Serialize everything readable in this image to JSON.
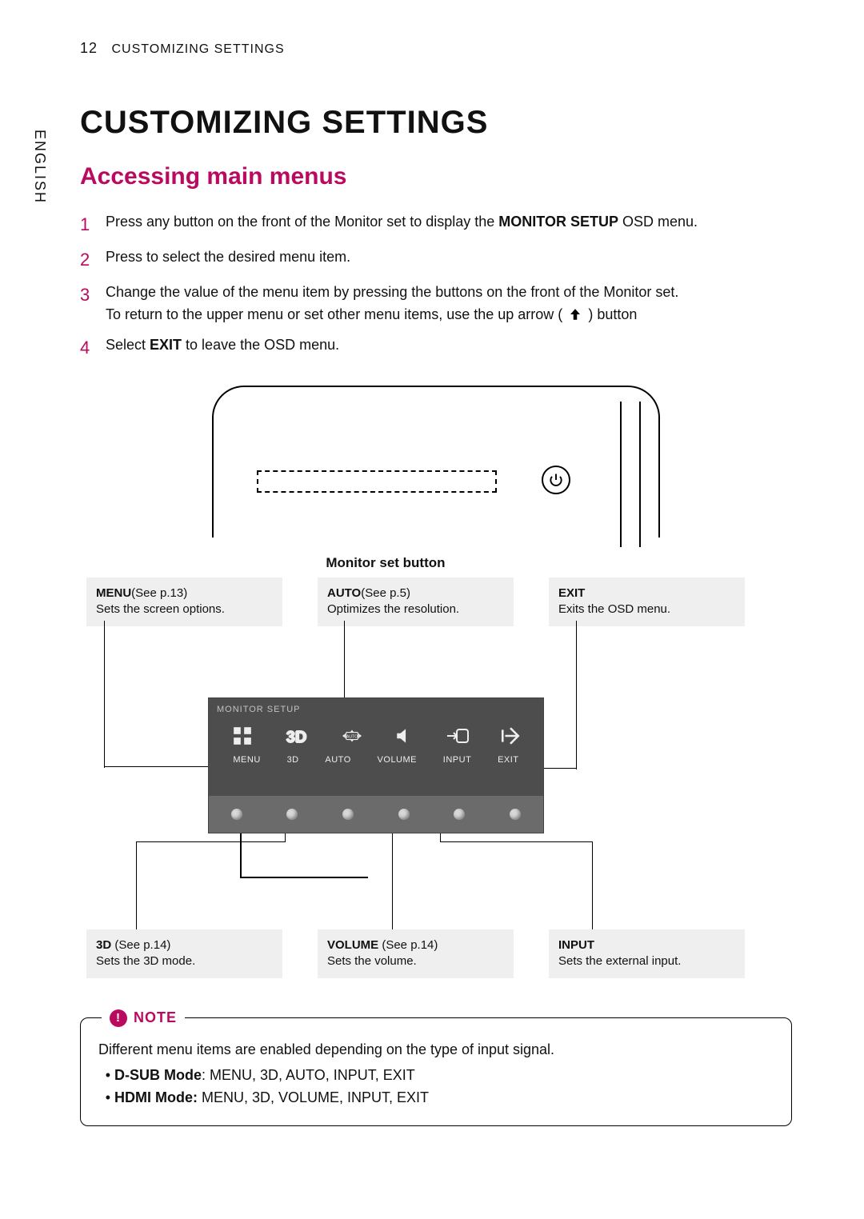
{
  "page_number": "12",
  "running_head": "CUSTOMIZING SETTINGS",
  "language_tab": "ENGLISH",
  "title": "CUSTOMIZING SETTINGS",
  "subtitle": "Accessing main menus",
  "steps": [
    {
      "num": "1",
      "pre": "Press any button on the front of the Monitor set to display the ",
      "bold": "MONITOR SETUP",
      "post": " OSD menu."
    },
    {
      "num": "2",
      "pre": "Press to select the desired menu item.",
      "bold": "",
      "post": ""
    },
    {
      "num": "3",
      "pre": "Change the value of the menu item by pressing the buttons on the front of the Monitor set.\nTo return to the upper menu or set other menu items, use the up arrow (",
      "bold": "",
      "post": ") button"
    },
    {
      "num": "4",
      "pre": "Select ",
      "bold": "EXIT",
      "post": " to leave the OSD menu."
    }
  ],
  "monitor_caption": "Monitor set button",
  "osd_title": "MONITOR SETUP",
  "osd_items": [
    "MENU",
    "3D",
    "AUTO",
    "VOLUME",
    "INPUT",
    "EXIT"
  ],
  "callouts": {
    "menu": {
      "title": "MENU",
      "ref": "(See p.13)",
      "desc": "Sets the screen options."
    },
    "auto": {
      "title": "AUTO",
      "ref": "(See p.5)",
      "desc": "Optimizes the resolution."
    },
    "exit": {
      "title": "EXIT",
      "ref": "",
      "desc": "Exits the OSD menu."
    },
    "three_d": {
      "title": "3D",
      "ref": "(See p.14)",
      "desc": "Sets the 3D mode."
    },
    "volume": {
      "title": "VOLUME",
      "ref": "(See p.14)",
      "desc": "Sets the volume."
    },
    "input": {
      "title": "INPUT",
      "ref": "",
      "desc": "Sets the external input."
    }
  },
  "note": {
    "label": "NOTE",
    "intro": "Different menu items are enabled depending on the type of input signal.",
    "items": [
      {
        "bold": "D-SUB Mode",
        "rest": ": MENU, 3D, AUTO, INPUT, EXIT"
      },
      {
        "bold": "HDMI Mode:",
        "rest": " MENU, 3D, VOLUME, INPUT, EXIT"
      }
    ]
  }
}
